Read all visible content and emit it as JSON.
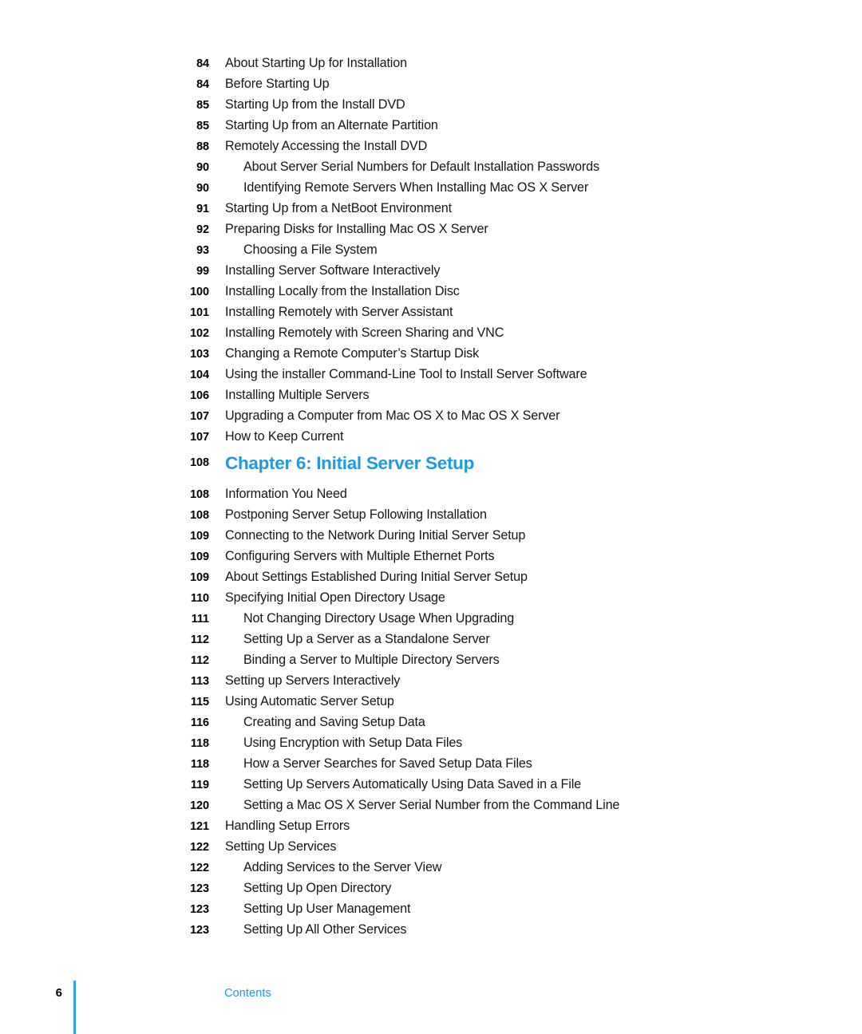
{
  "document": {
    "section_label": "Contents",
    "page_number": "6",
    "accent_color": "#1b9ae8",
    "rule_color": "#2ca3f5",
    "text_color": "#161616"
  },
  "toc": {
    "entries": [
      {
        "page": "84",
        "title": "About Starting Up for Installation",
        "level": 0,
        "type": "entry"
      },
      {
        "page": "84",
        "title": "Before Starting Up",
        "level": 0,
        "type": "entry"
      },
      {
        "page": "85",
        "title": "Starting Up from the Install DVD",
        "level": 0,
        "type": "entry"
      },
      {
        "page": "85",
        "title": "Starting Up from an Alternate Partition",
        "level": 0,
        "type": "entry"
      },
      {
        "page": "88",
        "title": "Remotely Accessing the Install DVD",
        "level": 0,
        "type": "entry"
      },
      {
        "page": "90",
        "title": "About Server Serial Numbers for Default Installation Passwords",
        "level": 1,
        "type": "entry"
      },
      {
        "page": "90",
        "title": "Identifying Remote Servers When Installing Mac OS X Server",
        "level": 1,
        "type": "entry"
      },
      {
        "page": "91",
        "title": "Starting Up from a NetBoot Environment",
        "level": 0,
        "type": "entry"
      },
      {
        "page": "92",
        "title": "Preparing Disks for Installing Mac OS X Server",
        "level": 0,
        "type": "entry"
      },
      {
        "page": "93",
        "title": "Choosing a File System",
        "level": 1,
        "type": "entry"
      },
      {
        "page": "99",
        "title": "Installing Server Software Interactively",
        "level": 0,
        "type": "entry"
      },
      {
        "page": "100",
        "title": "Installing Locally from the Installation Disc",
        "level": 0,
        "type": "entry"
      },
      {
        "page": "101",
        "title": "Installing Remotely with Server Assistant",
        "level": 0,
        "type": "entry"
      },
      {
        "page": "102",
        "title": "Installing Remotely with Screen Sharing and VNC",
        "level": 0,
        "type": "entry"
      },
      {
        "page": "103",
        "title": "Changing a Remote Computer’s Startup Disk",
        "level": 0,
        "type": "entry"
      },
      {
        "page": "104",
        "title": "Using the installer Command-Line Tool to Install Server Software",
        "level": 0,
        "type": "entry"
      },
      {
        "page": "106",
        "title": "Installing Multiple Servers",
        "level": 0,
        "type": "entry"
      },
      {
        "page": "107",
        "title": "Upgrading a Computer from Mac OS X to Mac OS X Server",
        "level": 0,
        "type": "entry"
      },
      {
        "page": "107",
        "title": "How to Keep Current",
        "level": 0,
        "type": "entry"
      },
      {
        "page": "108",
        "title": "Chapter 6: Initial Server Setup",
        "level": 0,
        "type": "chapter"
      },
      {
        "page": "108",
        "title": "Information You Need",
        "level": 0,
        "type": "entry"
      },
      {
        "page": "108",
        "title": "Postponing Server Setup Following Installation",
        "level": 0,
        "type": "entry"
      },
      {
        "page": "109",
        "title": "Connecting to the Network During Initial Server Setup",
        "level": 0,
        "type": "entry"
      },
      {
        "page": "109",
        "title": "Configuring Servers with Multiple Ethernet Ports",
        "level": 0,
        "type": "entry"
      },
      {
        "page": "109",
        "title": "About Settings Established During Initial Server Setup",
        "level": 0,
        "type": "entry"
      },
      {
        "page": "110",
        "title": "Specifying Initial Open Directory Usage",
        "level": 0,
        "type": "entry"
      },
      {
        "page": "111",
        "title": "Not Changing Directory Usage When Upgrading",
        "level": 1,
        "type": "entry"
      },
      {
        "page": "112",
        "title": "Setting Up a Server as a Standalone Server",
        "level": 1,
        "type": "entry"
      },
      {
        "page": "112",
        "title": "Binding a Server to Multiple Directory Servers",
        "level": 1,
        "type": "entry"
      },
      {
        "page": "113",
        "title": "Setting up Servers Interactively",
        "level": 0,
        "type": "entry"
      },
      {
        "page": "115",
        "title": "Using Automatic Server Setup",
        "level": 0,
        "type": "entry"
      },
      {
        "page": "116",
        "title": "Creating and Saving Setup Data",
        "level": 1,
        "type": "entry"
      },
      {
        "page": "118",
        "title": "Using Encryption with Setup Data Files",
        "level": 1,
        "type": "entry"
      },
      {
        "page": "118",
        "title": "How a Server Searches for Saved Setup Data Files",
        "level": 1,
        "type": "entry"
      },
      {
        "page": "119",
        "title": "Setting Up Servers Automatically Using Data Saved in a File",
        "level": 1,
        "type": "entry"
      },
      {
        "page": "120",
        "title": "Setting a Mac OS X Server Serial Number from the Command Line",
        "level": 1,
        "type": "entry"
      },
      {
        "page": "121",
        "title": "Handling Setup Errors",
        "level": 0,
        "type": "entry"
      },
      {
        "page": "122",
        "title": "Setting Up Services",
        "level": 0,
        "type": "entry"
      },
      {
        "page": "122",
        "title": "Adding Services to the Server View",
        "level": 1,
        "type": "entry"
      },
      {
        "page": "123",
        "title": "Setting Up Open Directory",
        "level": 1,
        "type": "entry"
      },
      {
        "page": "123",
        "title": "Setting Up User Management",
        "level": 1,
        "type": "entry"
      },
      {
        "page": "123",
        "title": "Setting Up All Other Services",
        "level": 1,
        "type": "entry"
      }
    ]
  }
}
